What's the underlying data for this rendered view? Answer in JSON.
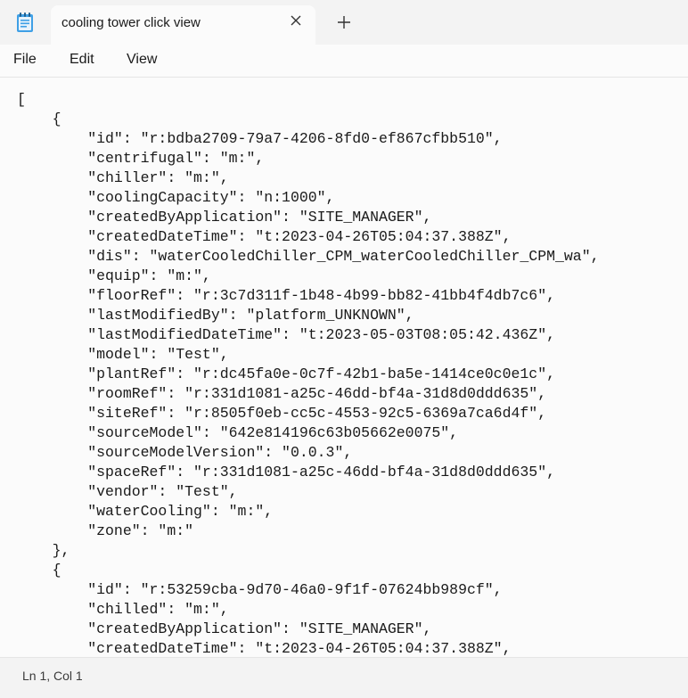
{
  "window": {
    "tab_title": "cooling tower click view",
    "app_icon": "notepad-icon",
    "close_icon": "close-icon",
    "new_tab_icon": "plus-icon"
  },
  "menu": {
    "file": "File",
    "edit": "Edit",
    "view": "View"
  },
  "editor": {
    "content": "[\n    {\n        \"id\": \"r:bdba2709-79a7-4206-8fd0-ef867cfbb510\",\n        \"centrifugal\": \"m:\",\n        \"chiller\": \"m:\",\n        \"coolingCapacity\": \"n:1000\",\n        \"createdByApplication\": \"SITE_MANAGER\",\n        \"createdDateTime\": \"t:2023-04-26T05:04:37.388Z\",\n        \"dis\": \"waterCooledChiller_CPM_waterCooledChiller_CPM_wa\",\n        \"equip\": \"m:\",\n        \"floorRef\": \"r:3c7d311f-1b48-4b99-bb82-41bb4f4db7c6\",\n        \"lastModifiedBy\": \"platform_UNKNOWN\",\n        \"lastModifiedDateTime\": \"t:2023-05-03T08:05:42.436Z\",\n        \"model\": \"Test\",\n        \"plantRef\": \"r:dc45fa0e-0c7f-42b1-ba5e-1414ce0c0e1c\",\n        \"roomRef\": \"r:331d1081-a25c-46dd-bf4a-31d8d0ddd635\",\n        \"siteRef\": \"r:8505f0eb-cc5c-4553-92c5-6369a7ca6d4f\",\n        \"sourceModel\": \"642e814196c63b05662e0075\",\n        \"sourceModelVersion\": \"0.0.3\",\n        \"spaceRef\": \"r:331d1081-a25c-46dd-bf4a-31d8d0ddd635\",\n        \"vendor\": \"Test\",\n        \"waterCooling\": \"m:\",\n        \"zone\": \"m:\"\n    },\n    {\n        \"id\": \"r:53259cba-9d70-46a0-9f1f-07624bb989cf\",\n        \"chilled\": \"m:\",\n        \"createdByApplication\": \"SITE_MANAGER\",\n        \"createdDateTime\": \"t:2023-04-26T05:04:37.388Z\","
  },
  "status": {
    "position": "Ln 1, Col 1"
  }
}
